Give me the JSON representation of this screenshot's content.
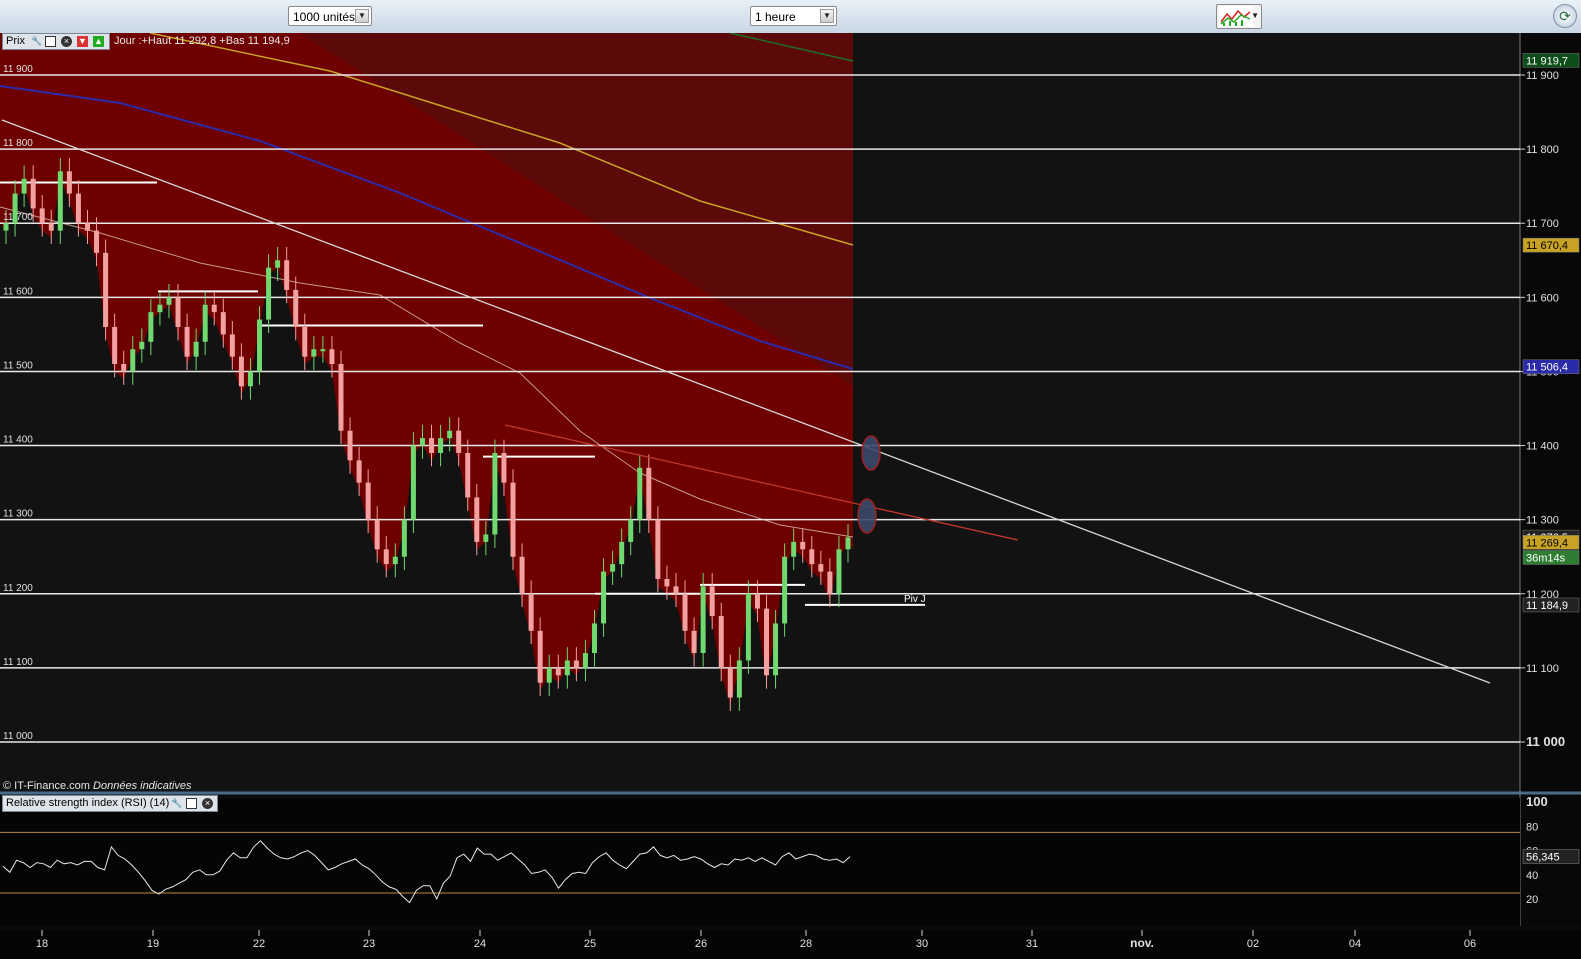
{
  "toolbar": {
    "units_select": "1000 unités",
    "period_select": "1 heure",
    "indicator_icon": "indicator-chart-icon",
    "refresh_icon": "refresh-icon"
  },
  "price_panel": {
    "label": "Prix",
    "header_icons": [
      "wrench-icon",
      "window-icon",
      "close-icon",
      "red-arrow-icon",
      "green-arrow-icon"
    ],
    "day_info": "Jour :+Haut 11 292,8 +Bas 11 194,9",
    "credit": "© IT-Finance.com",
    "credit_note": "Données indicatives",
    "pivot_label": "Piv J"
  },
  "rsi_panel": {
    "label": "Relative strength index (RSI) (14)",
    "header_icons": [
      "wrench-icon",
      "window-icon",
      "close-icon"
    ]
  },
  "colors": {
    "background": "#0b0b0b",
    "bearish_fill": "#6e0000",
    "ma_yellow": "#c7a225",
    "ma_blue": "#2b2baa",
    "ma_light": "#c79a8f",
    "trendline_white": "#d9d9d9",
    "trendline_red": "#c0392b",
    "candle_up": "#6fd86f",
    "candle_down": "#f2a0a0",
    "rsi_line": "#e8e8e8",
    "rsi_band": "#b58a3a"
  },
  "chart_data": [
    {
      "type": "candlestick",
      "title": "",
      "timeframe": "1 heure",
      "y_ticks_left": [
        "11 900",
        "11 800",
        "11 700",
        "11 600",
        "11 500",
        "11 400",
        "11 300",
        "11 200",
        "11 100",
        "11 000"
      ],
      "y_ticks_right": [
        "11 900",
        "11 800",
        "11 700",
        "11 600",
        "11 500",
        "11 400",
        "11 300",
        "11 200",
        "11 100",
        "11 000"
      ],
      "ylim": [
        10960,
        11955
      ],
      "x_ticks": [
        "18",
        "19",
        "22",
        "23",
        "24",
        "25",
        "26",
        "28",
        "30",
        "31",
        "nov.",
        "02",
        "04",
        "06"
      ],
      "price_tags": [
        {
          "label": "11 919,7",
          "value": 11919.7,
          "color": "#0d4d1a"
        },
        {
          "label": "11 670,4",
          "value": 11670.4,
          "color": "#c7a225"
        },
        {
          "label": "11 506,4",
          "value": 11506.4,
          "color": "#2b2baa"
        },
        {
          "label": "11 276,5",
          "value": 11276.5,
          "color": "#222222"
        },
        {
          "label": "11 269,4",
          "value": 11269.4,
          "color": "#c7a225"
        },
        {
          "label": "36m14s",
          "value": 11249,
          "color": "#2e7d32"
        },
        {
          "label": "11 184,9",
          "value": 11184.9,
          "color": "#222222"
        }
      ],
      "day_high": 11292.8,
      "day_low": 11194.9,
      "close_series": [
        11700,
        11740,
        11760,
        11720,
        11700,
        11690,
        11770,
        11740,
        11700,
        11690,
        11660,
        11560,
        11510,
        11500,
        11530,
        11540,
        11580,
        11590,
        11600,
        11560,
        11520,
        11540,
        11590,
        11580,
        11550,
        11520,
        11480,
        11500,
        11570,
        11640,
        11650,
        11610,
        11560,
        11520,
        11530,
        11530,
        11510,
        11420,
        11380,
        11350,
        11300,
        11260,
        11240,
        11250,
        11300,
        11400,
        11410,
        11390,
        11410,
        11420,
        11390,
        11330,
        11270,
        11280,
        11390,
        11350,
        11250,
        11200,
        11150,
        11080,
        11100,
        11090,
        11110,
        11100,
        11120,
        11160,
        11230,
        11240,
        11270,
        11300,
        11370,
        11300,
        11220,
        11210,
        11200,
        11150,
        11120,
        11210,
        11170,
        11100,
        11060,
        11110,
        11200,
        11180,
        11090,
        11160,
        11250,
        11270,
        11260,
        11240,
        11230,
        11200,
        11260,
        11276
      ]
    },
    {
      "type": "line",
      "title": "",
      "series_name": "",
      "ylim": [
        0,
        100
      ],
      "y_ticks": [
        "100",
        "80",
        "60",
        "40",
        "20"
      ],
      "bands": [
        75,
        25
      ],
      "current_value_label": "56,345",
      "values": [
        47,
        42,
        52,
        50,
        46,
        50,
        49,
        46,
        52,
        49,
        50,
        48,
        51,
        51,
        46,
        44,
        63,
        56,
        53,
        48,
        42,
        35,
        27,
        24,
        28,
        30,
        33,
        36,
        42,
        44,
        40,
        40,
        43,
        52,
        58,
        54,
        54,
        63,
        68,
        62,
        57,
        54,
        53,
        55,
        58,
        60,
        56,
        50,
        44,
        46,
        49,
        51,
        53,
        48,
        45,
        40,
        34,
        30,
        28,
        22,
        17,
        27,
        31,
        31,
        20,
        33,
        39,
        54,
        57,
        51,
        62,
        57,
        57,
        52,
        55,
        58,
        53,
        48,
        41,
        42,
        44,
        38,
        29,
        36,
        41,
        42,
        41,
        50,
        55,
        58,
        52,
        48,
        45,
        51,
        57,
        58,
        63,
        56,
        54,
        56,
        52,
        53,
        55,
        53,
        49,
        46,
        49,
        48,
        53,
        52,
        54,
        51,
        54,
        51,
        48,
        55,
        58,
        53,
        55,
        57,
        56,
        53,
        52,
        53,
        50,
        55
      ]
    }
  ]
}
